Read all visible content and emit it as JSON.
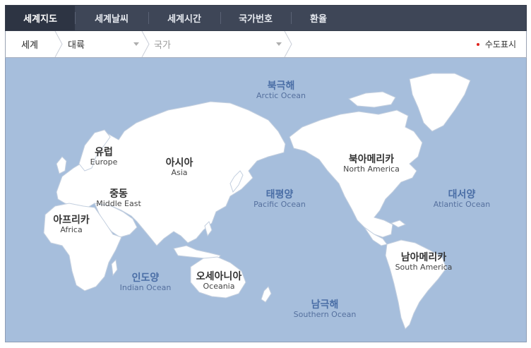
{
  "tabs": [
    {
      "label": "세계지도",
      "active": true
    },
    {
      "label": "세계날씨",
      "active": false
    },
    {
      "label": "세계시간",
      "active": false
    },
    {
      "label": "국가번호",
      "active": false
    },
    {
      "label": "환율",
      "active": false
    }
  ],
  "breadcrumb": {
    "world": "세계",
    "continent": "대륙",
    "country": "국가"
  },
  "capital_toggle": "수도표시",
  "colors": {
    "ocean": "#a6bedc",
    "land": "#ffffff",
    "tab_bar": "#3e4657",
    "ocean_label": "#4a6ea6",
    "capital_dot": "#e0231c"
  },
  "map": {
    "continents": [
      {
        "id": "europe",
        "ko": "유럽",
        "en": "Europe"
      },
      {
        "id": "asia",
        "ko": "아시아",
        "en": "Asia"
      },
      {
        "id": "middle-east",
        "ko": "중동",
        "en": "Middle East"
      },
      {
        "id": "africa",
        "ko": "아프리카",
        "en": "Africa"
      },
      {
        "id": "oceania",
        "ko": "오세아니아",
        "en": "Oceania"
      },
      {
        "id": "north-america",
        "ko": "북아메리카",
        "en": "North America"
      },
      {
        "id": "south-america",
        "ko": "남아메리카",
        "en": "South America"
      }
    ],
    "oceans": [
      {
        "id": "arctic",
        "ko": "북극해",
        "en": "Arctic Ocean"
      },
      {
        "id": "pacific",
        "ko": "태평양",
        "en": "Pacific Ocean"
      },
      {
        "id": "atlantic",
        "ko": "대서양",
        "en": "Atlantic Ocean"
      },
      {
        "id": "indian",
        "ko": "인도양",
        "en": "Indian Ocean"
      },
      {
        "id": "southern",
        "ko": "남극해",
        "en": "Southern Ocean"
      }
    ]
  }
}
